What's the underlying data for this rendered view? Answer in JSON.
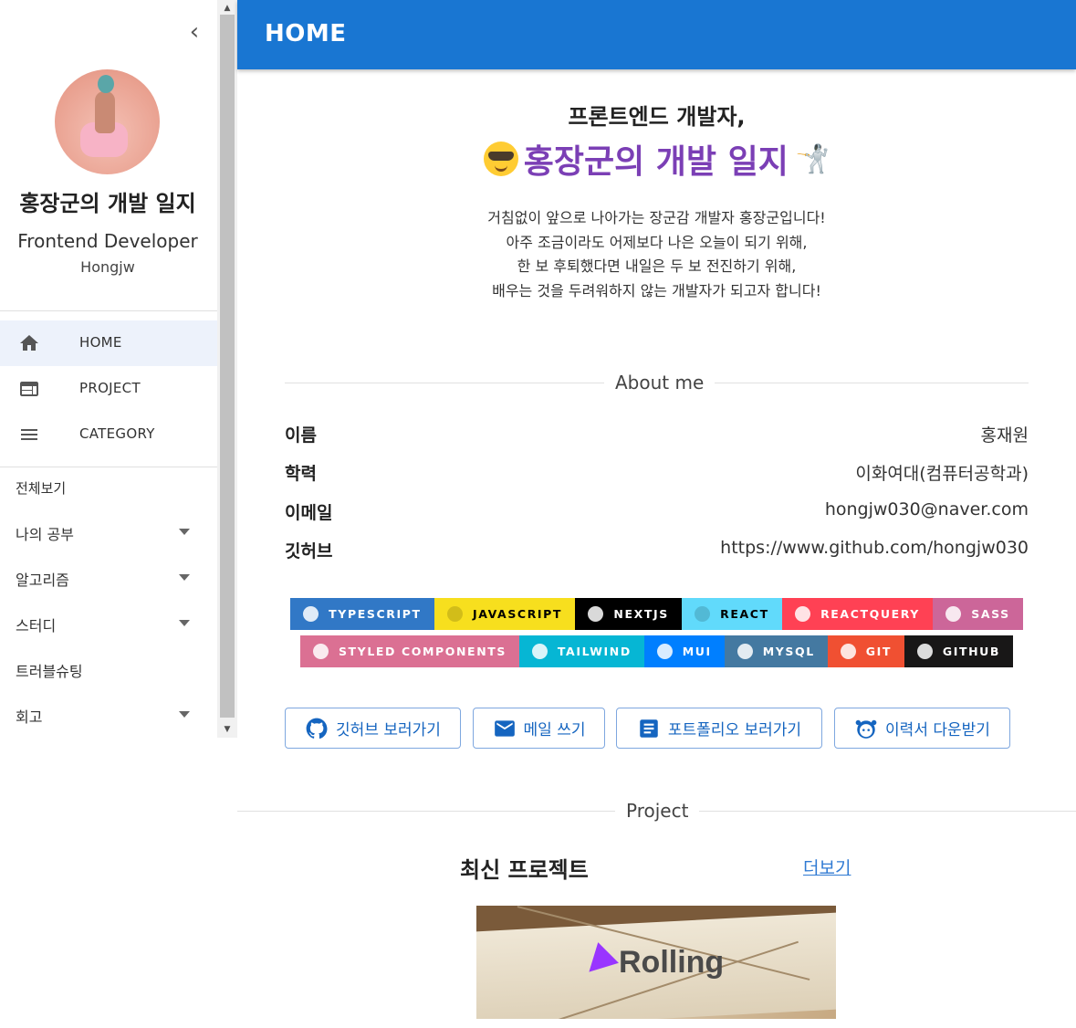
{
  "sidebar": {
    "blog_title": "홍장군의 개발 일지",
    "role": "Frontend Developer",
    "username": "Hongjw",
    "nav": [
      {
        "label": "HOME",
        "icon": "home-icon",
        "active": true
      },
      {
        "label": "PROJECT",
        "icon": "web-icon",
        "active": false
      },
      {
        "label": "CATEGORY",
        "icon": "menu-icon",
        "active": false
      }
    ],
    "categories": [
      {
        "label": "전체보기",
        "expandable": false
      },
      {
        "label": "나의 공부",
        "expandable": true
      },
      {
        "label": "알고리즘",
        "expandable": true
      },
      {
        "label": "스터디",
        "expandable": true
      },
      {
        "label": "트러블슈팅",
        "expandable": false
      },
      {
        "label": "회고",
        "expandable": true
      }
    ]
  },
  "appbar": {
    "title": "HOME",
    "color": "#1976d2"
  },
  "intro": {
    "line1": "프론트엔드 개발자,",
    "name": "홍장군의 개발 일지",
    "description": [
      "거침없이 앞으로 나아가는 장군감 개발자 홍장군입니다!",
      "아주 조금이라도 어제보다 나은 오늘이 되기 위해,",
      "한 보 후퇴했다면 내일은 두 보 전진하기 위해,",
      "배우는 것을 두려워하지 않는 개발자가 되고자 합니다!"
    ]
  },
  "about": {
    "heading": "About me",
    "rows": [
      {
        "key": "이름",
        "value": "홍재원"
      },
      {
        "key": "학력",
        "value": "이화여대(컴퓨터공학과)"
      },
      {
        "key": "이메일",
        "value": "hongjw030@naver.com"
      },
      {
        "key": "깃허브",
        "value": "https://www.github.com/hongjw030"
      }
    ]
  },
  "badges": {
    "row1": [
      {
        "label": "TYPESCRIPT",
        "bg": "#3178c6",
        "fg": "#ffffff",
        "icon": "typescript-icon"
      },
      {
        "label": "JAVASCRIPT",
        "bg": "#f7df1e",
        "fg": "#000000",
        "icon": "javascript-icon"
      },
      {
        "label": "NEXTJS",
        "bg": "#000000",
        "fg": "#ffffff",
        "icon": "nextjs-icon"
      },
      {
        "label": "REACT",
        "bg": "#61dafb",
        "fg": "#000000",
        "icon": "react-icon"
      },
      {
        "label": "REACTQUERY",
        "bg": "#ff4154",
        "fg": "#ffffff",
        "icon": "reactquery-icon"
      },
      {
        "label": "SASS",
        "bg": "#cc6699",
        "fg": "#ffffff",
        "icon": "sass-icon"
      }
    ],
    "row2": [
      {
        "label": "STYLED COMPONENTS",
        "bg": "#db7093",
        "fg": "#ffffff",
        "icon": "styled-components-icon"
      },
      {
        "label": "TAILWIND",
        "bg": "#06b6d4",
        "fg": "#ffffff",
        "icon": "tailwind-icon"
      },
      {
        "label": "MUI",
        "bg": "#007fff",
        "fg": "#ffffff",
        "icon": "mui-icon"
      },
      {
        "label": "MYSQL",
        "bg": "#4479a1",
        "fg": "#ffffff",
        "icon": "mysql-icon"
      },
      {
        "label": "GIT",
        "bg": "#f05032",
        "fg": "#ffffff",
        "icon": "git-icon"
      },
      {
        "label": "GITHUB",
        "bg": "#181717",
        "fg": "#ffffff",
        "icon": "github-icon"
      }
    ]
  },
  "buttons": [
    {
      "label": "깃허브 보러가기",
      "icon": "github-icon"
    },
    {
      "label": "메일 쓰기",
      "icon": "mail-icon"
    },
    {
      "label": "포트폴리오 보러가기",
      "icon": "document-icon"
    },
    {
      "label": "이력서 다운받기",
      "icon": "face-icon"
    }
  ],
  "project": {
    "heading": "Project",
    "latest_label": "최신 프로젝트",
    "more_label": "더보기",
    "card": {
      "name": "Rolling",
      "icon": "paper-plane-icon"
    }
  }
}
